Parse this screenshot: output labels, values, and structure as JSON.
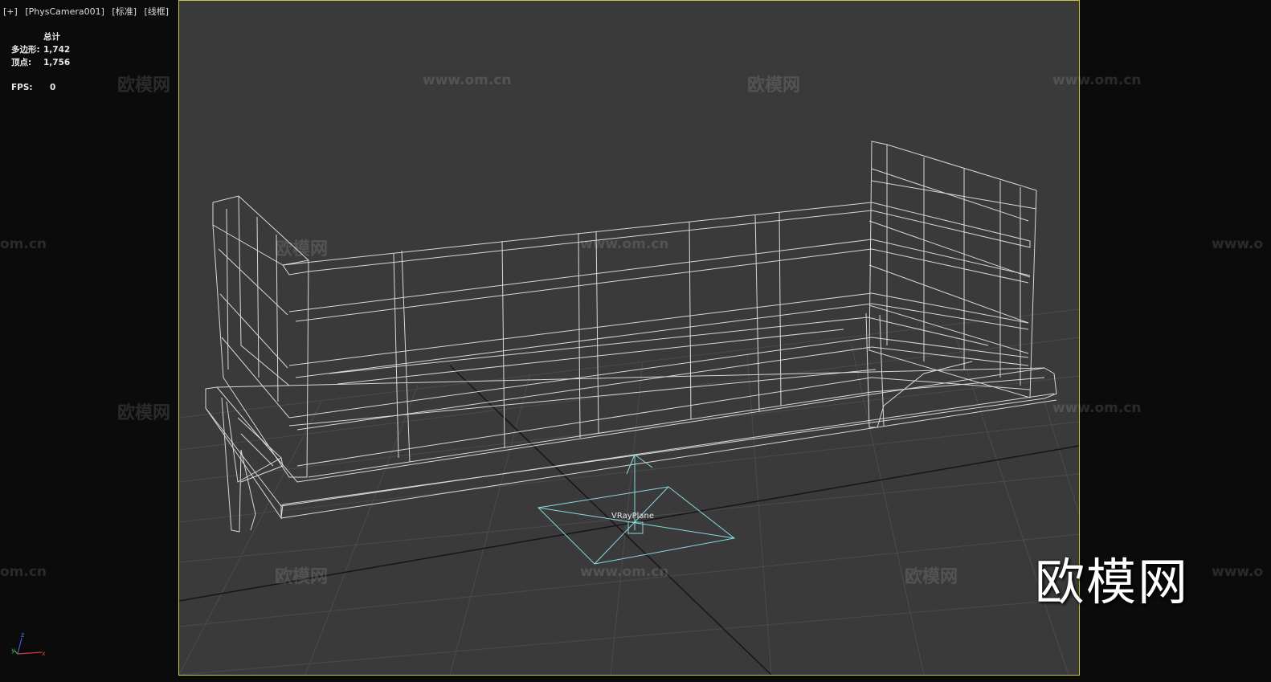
{
  "viewport": {
    "label_plus": "[+]",
    "label_camera": "[PhysCamera001]",
    "label_shading": "[标准]",
    "label_mode": "[线框]"
  },
  "stats": {
    "total_label": "总计",
    "polygons_label": "多边形:",
    "polygons_value": "1,742",
    "vertices_label": "顶点:",
    "vertices_value": "1,756",
    "fps_label": "FPS:",
    "fps_value": "0"
  },
  "scene": {
    "object_label": "VRayPlane"
  },
  "watermark": {
    "brand": "欧模网",
    "url": "www.om.cn",
    "url_cut": "om.cn",
    "url_left": "www.o"
  },
  "axis": {
    "x": "x",
    "y": "y",
    "z": "z"
  },
  "colors": {
    "viewport_bg": "#3a3a3a",
    "frame_border": "#c8c83a",
    "wire": "#e6e6e6",
    "grid": "#4c4c4c",
    "selected": "#8ad8e0"
  }
}
